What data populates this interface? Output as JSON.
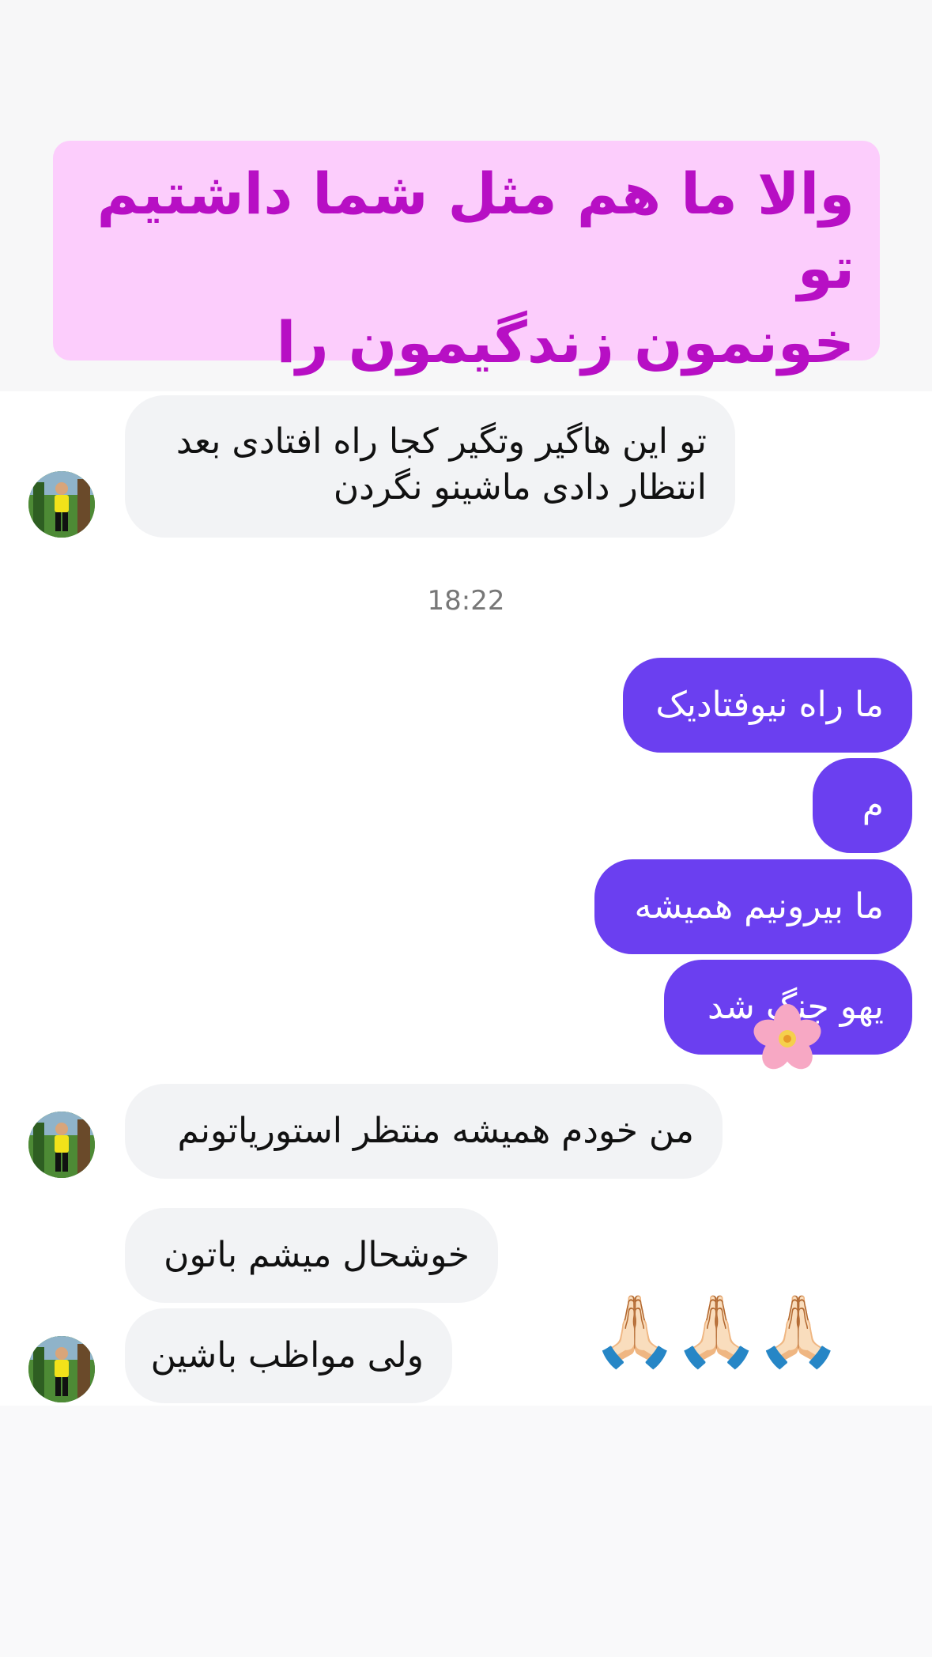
{
  "caption": {
    "line1": "والا ما هم مثل شما داشتیم تو",
    "line2": "خونمون زندگیمون را میکردیم"
  },
  "messages": [
    {
      "side": "received",
      "lines": [
        "تو این هاگیر وتگیر کجا راه افتادی بعد",
        "انتظار دادی ماشینو نگردن"
      ]
    },
    {
      "side": "timestamp",
      "text": "18:22"
    },
    {
      "side": "sent",
      "text": "ما راه نیوفتادیک"
    },
    {
      "side": "sent",
      "text": "م"
    },
    {
      "side": "sent",
      "text": "ما بیرونیم همیشه"
    },
    {
      "side": "sent",
      "text": "یهو جنگ شد",
      "reaction": "flower-emoji"
    },
    {
      "side": "received",
      "text": "من خودم همیشه منتظر  استوریاتونم"
    },
    {
      "side": "received",
      "text": "خوشحال میشم باتون"
    },
    {
      "side": "received",
      "text": "ولی مواظب باشین"
    }
  ],
  "emoji_reaction": {
    "text": "🙏🏻🙏🏻🙏🏻",
    "icon": "praying-hands-icon"
  },
  "colors": {
    "sent_bubble": "#6b3ff0",
    "received_bubble": "#f2f3f5",
    "caption_bg": "#fccdfc",
    "caption_text": "#b70fc4"
  }
}
